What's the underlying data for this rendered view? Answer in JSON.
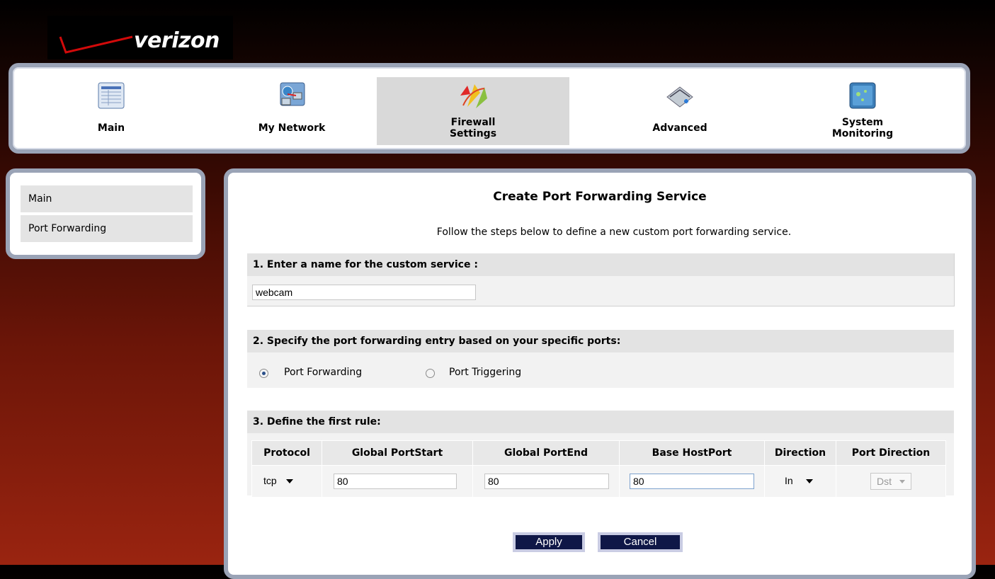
{
  "brand": {
    "logo_text": "verizon"
  },
  "topnav": [
    {
      "label": "Main",
      "icon": "main-table-icon",
      "active": false
    },
    {
      "label": "My Network",
      "icon": "my-network-icon",
      "active": false
    },
    {
      "label": "Firewall\nSettings",
      "icon": "firewall-icon",
      "active": true
    },
    {
      "label": "Advanced",
      "icon": "advanced-tools-icon",
      "active": false
    },
    {
      "label": "System\nMonitoring",
      "icon": "system-monitoring-icon",
      "active": false
    }
  ],
  "sidebar": {
    "items": [
      {
        "label": "Main"
      },
      {
        "label": "Port Forwarding"
      }
    ]
  },
  "page": {
    "title": "Create Port Forwarding Service",
    "description": "Follow the steps below to define a new custom port forwarding service."
  },
  "step1": {
    "heading": "1. Enter a name for the custom service :",
    "name_value": "webcam"
  },
  "step2": {
    "heading": "2. Specify the port forwarding entry based on your specific ports:",
    "options": [
      {
        "label": "Port Forwarding",
        "checked": true
      },
      {
        "label": "Port Triggering",
        "checked": false
      }
    ]
  },
  "step3": {
    "heading": "3. Define the first rule:",
    "columns": [
      "Protocol",
      "Global PortStart",
      "Global PortEnd",
      "Base HostPort",
      "Direction",
      "Port Direction"
    ],
    "row": {
      "protocol": "tcp",
      "global_port_start": "80",
      "global_port_end": "80",
      "base_host_port": "80",
      "direction": "In",
      "port_direction": "Dst"
    }
  },
  "buttons": {
    "apply": "Apply",
    "cancel": "Cancel"
  },
  "colors": {
    "button_bg": "#0f1747",
    "nav_border": "#9aa3b6",
    "active_tab": "#d9d9d9",
    "background_red": "#9a2410"
  }
}
